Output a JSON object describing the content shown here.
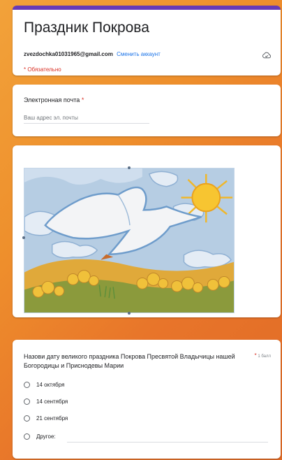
{
  "form": {
    "title": "Праздник Покрова",
    "account_email": "zvezdochka01031965@gmail.com",
    "switch_account": "Сменить аккаунт",
    "required_note": "* Обязательно",
    "accent_color": "#673ab7"
  },
  "email_question": {
    "label": "Электронная почта",
    "required_mark": "*",
    "placeholder": "Ваш адрес эл. почты"
  },
  "image_block": {
    "image_name": "drawing-dove-and-sun"
  },
  "question": {
    "text": "Назови дату великого праздника Покрова Пресвятой Владычицы нашей Богородицы и Приснодевы Марии",
    "required_mark": "*",
    "points": "1 балл",
    "options": [
      {
        "label": "14 октября"
      },
      {
        "label": "14 сентября"
      },
      {
        "label": "21 сентября"
      },
      {
        "label": "Другое:"
      }
    ]
  }
}
